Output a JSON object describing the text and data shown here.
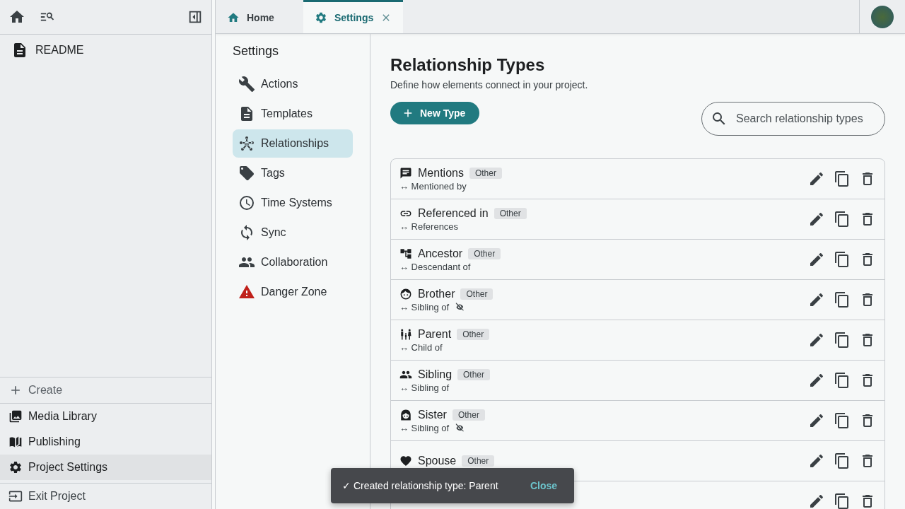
{
  "sidebar": {
    "tree": [
      {
        "label": "README"
      }
    ],
    "create": "Create",
    "nav": [
      {
        "label": "Media Library",
        "selected": false
      },
      {
        "label": "Publishing",
        "selected": false
      },
      {
        "label": "Project Settings",
        "selected": true
      }
    ],
    "exit": "Exit Project"
  },
  "tabs": [
    {
      "label": "Home",
      "selected": false
    },
    {
      "label": "Settings",
      "selected": true
    }
  ],
  "settings_nav": {
    "title": "Settings",
    "items": [
      {
        "label": "Actions",
        "selected": false
      },
      {
        "label": "Templates",
        "selected": false
      },
      {
        "label": "Relationships",
        "selected": true
      },
      {
        "label": "Tags",
        "selected": false
      },
      {
        "label": "Time Systems",
        "selected": false
      },
      {
        "label": "Sync",
        "selected": false
      },
      {
        "label": "Collaboration",
        "selected": false
      },
      {
        "label": "Danger Zone",
        "selected": false
      }
    ]
  },
  "page": {
    "title": "Relationship Types",
    "subtitle": "Define how elements connect in your project.",
    "new_button": "New Type",
    "search": {
      "placeholder": "Search relationship types"
    }
  },
  "relationship_types": [
    {
      "name": "Mentions",
      "badge": "Other",
      "inverse": "↔ Mentioned by",
      "hidden": false
    },
    {
      "name": "Referenced in",
      "badge": "Other",
      "inverse": "↔ References",
      "hidden": false
    },
    {
      "name": "Ancestor",
      "badge": "Other",
      "inverse": "↔ Descendant of",
      "hidden": false
    },
    {
      "name": "Brother",
      "badge": "Other",
      "inverse": "↔ Sibling of",
      "hidden": true
    },
    {
      "name": "Parent",
      "badge": "Other",
      "inverse": "↔ Child of",
      "hidden": false
    },
    {
      "name": "Sibling",
      "badge": "Other",
      "inverse": "↔ Sibling of",
      "hidden": false
    },
    {
      "name": "Sister",
      "badge": "Other",
      "inverse": "↔ Sibling of",
      "hidden": true
    },
    {
      "name": "Spouse",
      "badge": "Other",
      "hidden": false
    },
    {
      "hidden": false
    }
  ],
  "toast": {
    "message": "✓ Created relationship type: Parent",
    "action": "Close"
  }
}
